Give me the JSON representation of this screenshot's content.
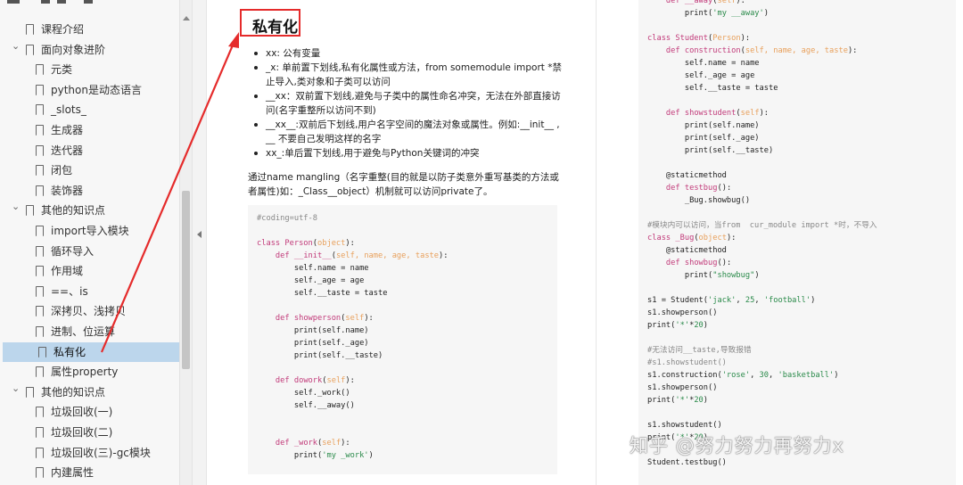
{
  "sidebar": {
    "items": [
      {
        "label": "课程介绍",
        "level": 1,
        "expanded": null,
        "active": false
      },
      {
        "label": "面向对象进阶",
        "level": 1,
        "expanded": true,
        "active": false
      },
      {
        "label": "元类",
        "level": 2,
        "active": false
      },
      {
        "label": "python是动态语言",
        "level": 2,
        "active": false
      },
      {
        "label": "_slots_",
        "level": 2,
        "active": false
      },
      {
        "label": "生成器",
        "level": 2,
        "active": false
      },
      {
        "label": "迭代器",
        "level": 2,
        "active": false
      },
      {
        "label": "闭包",
        "level": 2,
        "active": false
      },
      {
        "label": "装饰器",
        "level": 2,
        "active": false
      },
      {
        "label": "其他的知识点",
        "level": 1,
        "expanded": true,
        "active": false
      },
      {
        "label": "import导入模块",
        "level": 2,
        "active": false
      },
      {
        "label": "循环导入",
        "level": 2,
        "active": false
      },
      {
        "label": "作用域",
        "level": 2,
        "active": false
      },
      {
        "label": "==、is",
        "level": 2,
        "active": false
      },
      {
        "label": "深拷贝、浅拷贝",
        "level": 2,
        "active": false
      },
      {
        "label": "进制、位运算",
        "level": 2,
        "active": false
      },
      {
        "label": "私有化",
        "level": 2,
        "active": true
      },
      {
        "label": "属性property",
        "level": 2,
        "active": false
      },
      {
        "label": "其他的知识点",
        "level": 1,
        "expanded": true,
        "active": false
      },
      {
        "label": "垃圾回收(一)",
        "level": 2,
        "active": false
      },
      {
        "label": "垃圾回收(二)",
        "level": 2,
        "active": false
      },
      {
        "label": "垃圾回收(三)-gc模块",
        "level": 2,
        "active": false
      },
      {
        "label": "内建属性",
        "level": 2,
        "active": false
      }
    ]
  },
  "document": {
    "heading": "私有化",
    "bullets": [
      "xx: 公有变量",
      "_x: 单前置下划线,私有化属性或方法，from somemodule import *禁止导入,类对象和子类可以访问",
      "__xx：双前置下划线,避免与子类中的属性命名冲突，无法在外部直接访问(名字重整所以访问不到)",
      "__xx__:双前后下划线,用户名字空间的魔法对象或属性。例如:__init__ , __ 不要自己发明这样的名字",
      "xx_:单后置下划线,用于避免与Python关键词的冲突"
    ],
    "paragraph": "通过name mangling（名字重整(目的就是以防子类意外重写基类的方法或者属性)如：_Class__object）机制就可以访问private了。",
    "code_left": [
      {
        "t": "#coding=utf-8",
        "c": "com"
      },
      {
        "t": "",
        "c": ""
      },
      {
        "t": "class Person(object):",
        "c": "code"
      },
      {
        "t": "    def __init__(self, name, age, taste):",
        "c": "code"
      },
      {
        "t": "        self.name = name",
        "c": "code"
      },
      {
        "t": "        self._age = age",
        "c": "code"
      },
      {
        "t": "        self.__taste = taste",
        "c": "code"
      },
      {
        "t": "",
        "c": ""
      },
      {
        "t": "    def showperson(self):",
        "c": "code"
      },
      {
        "t": "        print(self.name)",
        "c": "code"
      },
      {
        "t": "        print(self._age)",
        "c": "code"
      },
      {
        "t": "        print(self.__taste)",
        "c": "code"
      },
      {
        "t": "",
        "c": ""
      },
      {
        "t": "    def dowork(self):",
        "c": "code"
      },
      {
        "t": "        self._work()",
        "c": "code"
      },
      {
        "t": "        self.__away()",
        "c": "code"
      },
      {
        "t": "",
        "c": ""
      },
      {
        "t": "",
        "c": ""
      },
      {
        "t": "    def _work(self):",
        "c": "code"
      },
      {
        "t": "        print('my _work')",
        "c": "code"
      }
    ],
    "code_right": [
      {
        "t": "    def __away(self):",
        "c": "code"
      },
      {
        "t": "        print('my __away')",
        "c": "code"
      },
      {
        "t": "",
        "c": ""
      },
      {
        "t": "class Student(Person):",
        "c": "code"
      },
      {
        "t": "    def construction(self, name, age, taste):",
        "c": "code"
      },
      {
        "t": "        self.name = name",
        "c": "code"
      },
      {
        "t": "        self._age = age",
        "c": "code"
      },
      {
        "t": "        self.__taste = taste",
        "c": "code"
      },
      {
        "t": "",
        "c": ""
      },
      {
        "t": "    def showstudent(self):",
        "c": "code"
      },
      {
        "t": "        print(self.name)",
        "c": "code"
      },
      {
        "t": "        print(self._age)",
        "c": "code"
      },
      {
        "t": "        print(self.__taste)",
        "c": "code"
      },
      {
        "t": "",
        "c": ""
      },
      {
        "t": "    @staticmethod",
        "c": "code"
      },
      {
        "t": "    def testbug():",
        "c": "code"
      },
      {
        "t": "        _Bug.showbug()",
        "c": "code"
      },
      {
        "t": "",
        "c": ""
      },
      {
        "t": "#模块内可以访问，当from  cur_module import *时，不导入",
        "c": "com"
      },
      {
        "t": "class _Bug(object):",
        "c": "code"
      },
      {
        "t": "    @staticmethod",
        "c": "code"
      },
      {
        "t": "    def showbug():",
        "c": "code"
      },
      {
        "t": "        print(\"showbug\")",
        "c": "code"
      },
      {
        "t": "",
        "c": ""
      },
      {
        "t": "s1 = Student('jack', 25, 'football')",
        "c": "code"
      },
      {
        "t": "s1.showperson()",
        "c": "code"
      },
      {
        "t": "print('*'*20)",
        "c": "code"
      },
      {
        "t": "",
        "c": ""
      },
      {
        "t": "#无法访问__taste,导致报错",
        "c": "com"
      },
      {
        "t": "#s1.showstudent()",
        "c": "com"
      },
      {
        "t": "s1.construction('rose', 30, 'basketball')",
        "c": "code"
      },
      {
        "t": "s1.showperson()",
        "c": "code"
      },
      {
        "t": "print('*'*20)",
        "c": "code"
      },
      {
        "t": "",
        "c": ""
      },
      {
        "t": "s1.showstudent()",
        "c": "code"
      },
      {
        "t": "print('*'*20)",
        "c": "code"
      },
      {
        "t": "",
        "c": ""
      },
      {
        "t": "Student.testbug()",
        "c": "code"
      }
    ]
  },
  "watermark": "知乎 @努力努力再努力x",
  "colors": {
    "accent_red": "#e52b2b",
    "active_row": "#bcd6ec",
    "keyword": "#c23b7a",
    "param": "#e8a05c",
    "string": "#2a8a4a",
    "comment": "#888888"
  }
}
